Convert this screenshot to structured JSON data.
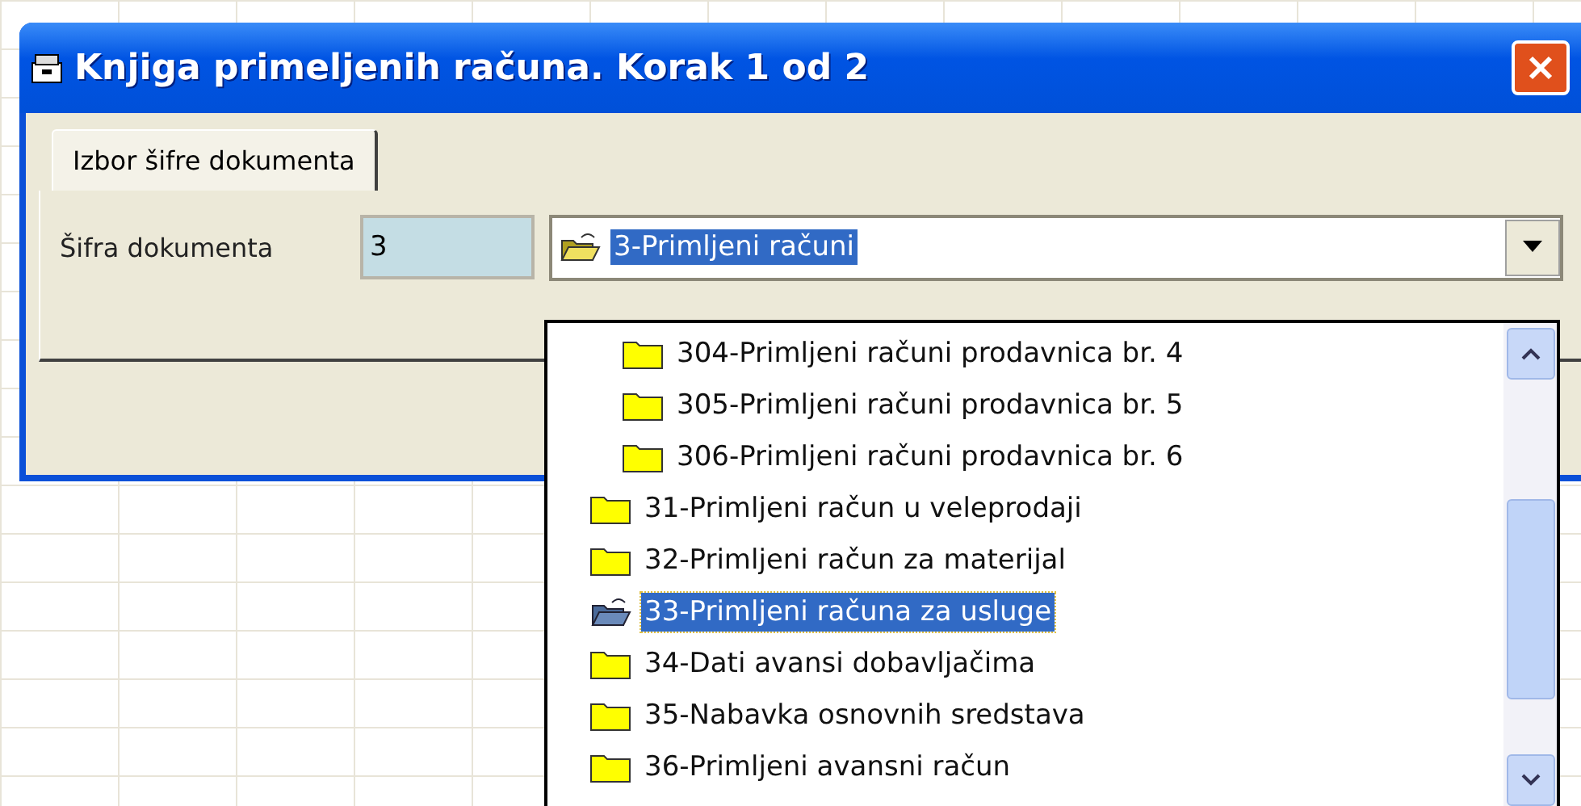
{
  "window": {
    "title": "Knjiga primeljenih računa. Korak 1 od 2"
  },
  "tabs": [
    {
      "label": "Izbor šifre dokumenta",
      "selected": true
    }
  ],
  "form": {
    "label": "Šifra dokumenta",
    "code": "3",
    "document": {
      "value": "3-Primljeni računi",
      "expanded": true
    }
  },
  "dropdown": {
    "items": [
      {
        "children": [
          {
            "label": "304-Primljeni računi prodavnica br. 4",
            "selected": false
          },
          {
            "label": "305-Primljeni računi prodavnica br. 5",
            "selected": false
          },
          {
            "label": "306-Primljeni računi prodavnica br. 6",
            "selected": false
          }
        ]
      },
      {
        "label": "31-Primljeni račun u veleprodaji",
        "selected": false
      },
      {
        "label": "32-Primljeni račun za materijal",
        "selected": false
      },
      {
        "label": "33-Primljeni računa za usluge",
        "selected": true
      },
      {
        "label": "34-Dati avansi dobavljačima",
        "selected": false
      },
      {
        "label": "35-Nabavka osnovnih sredstava",
        "selected": false
      },
      {
        "label": "36-Primljeni avansni račun",
        "selected": false
      }
    ]
  }
}
